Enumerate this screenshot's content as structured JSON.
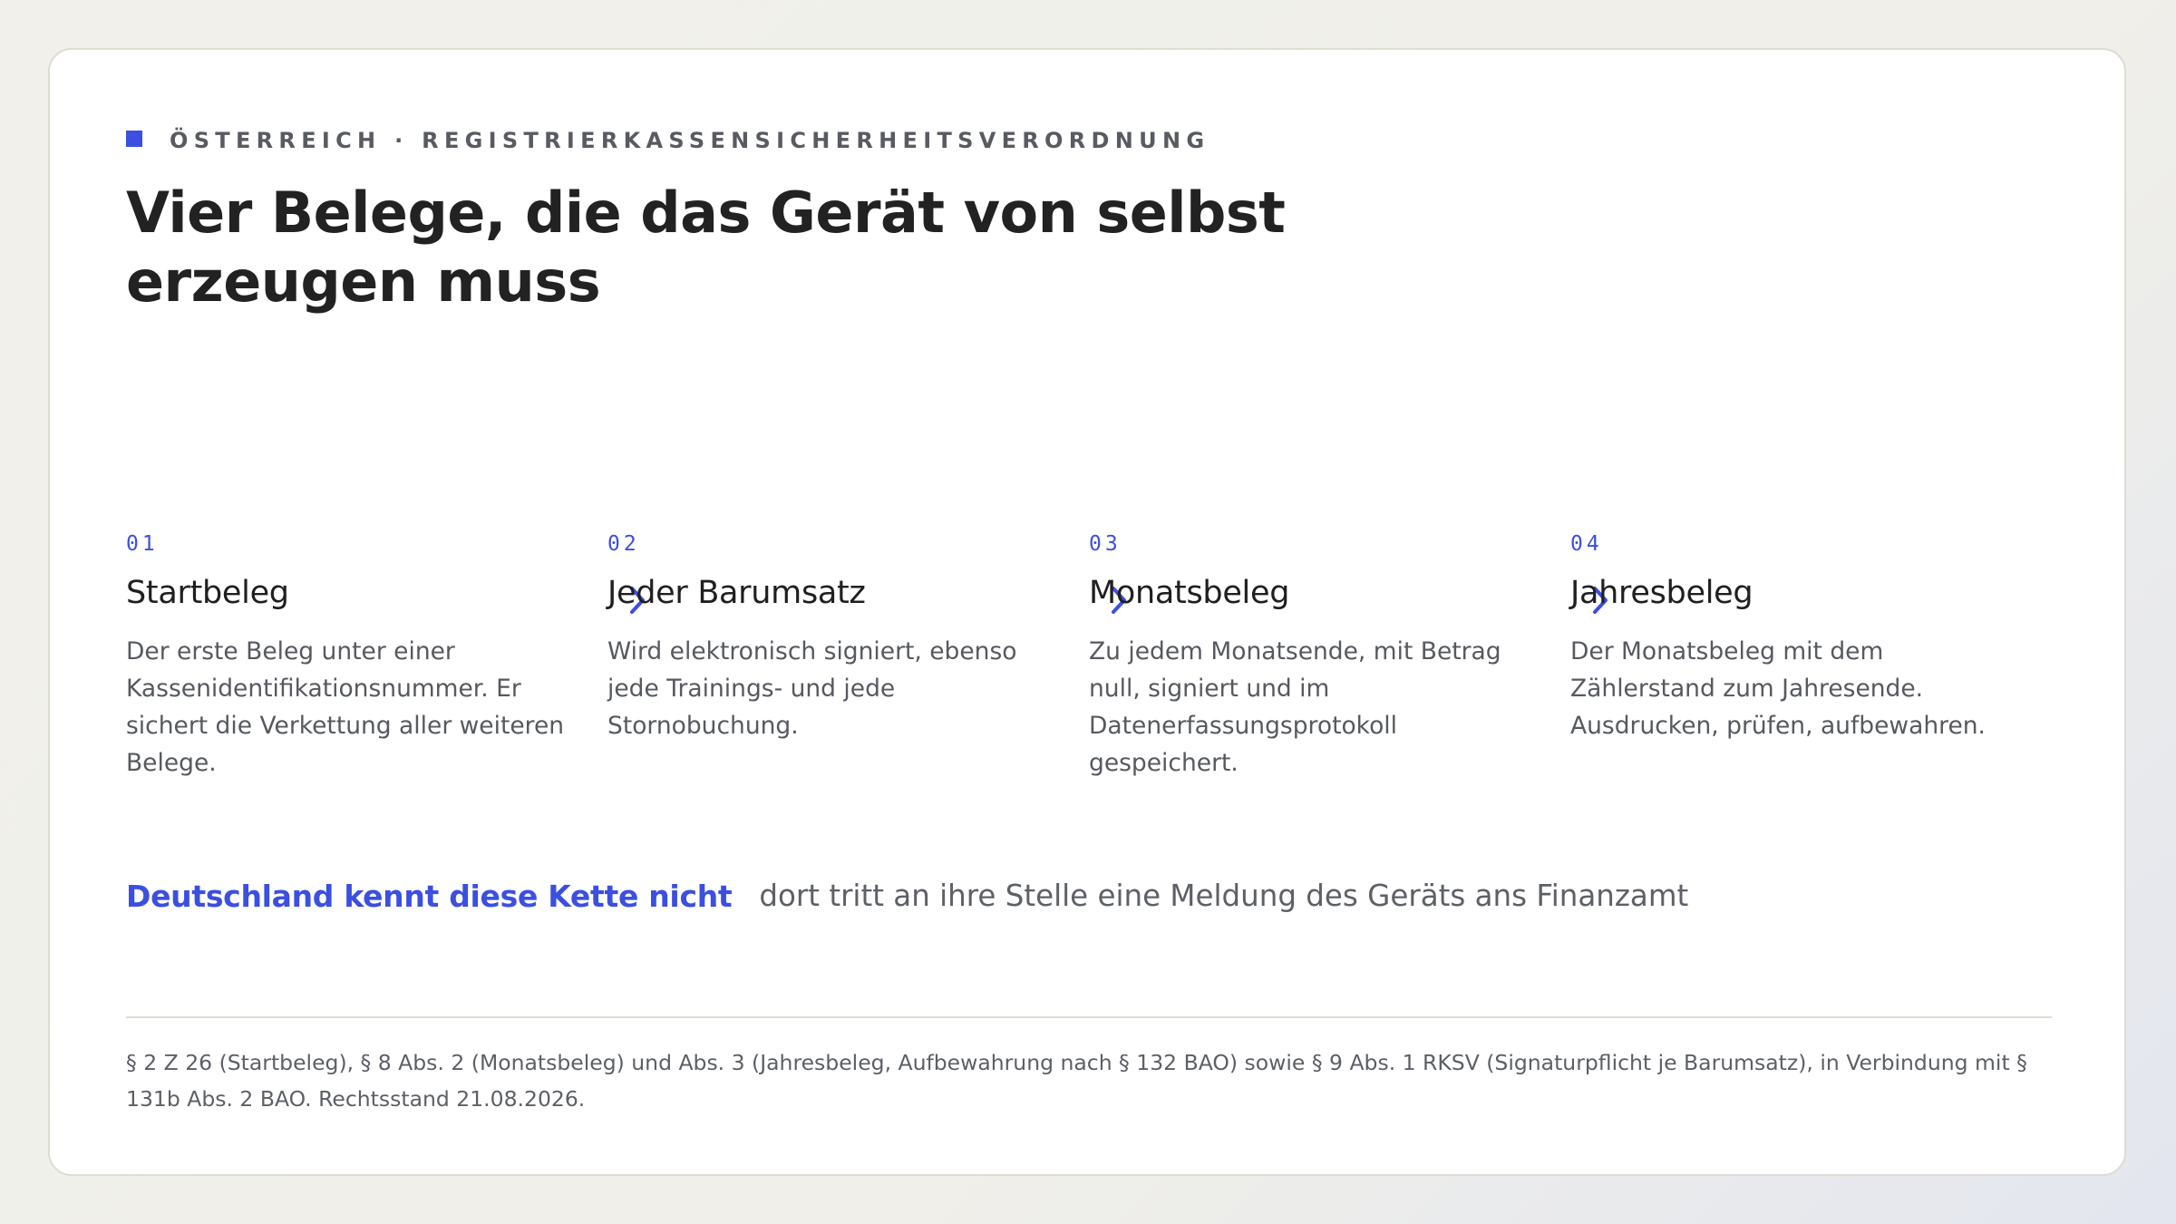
{
  "eyebrow": "ÖSTERREICH · REGISTRIERKASSENSICHERHEITSVERORDNUNG",
  "title": "Vier Belege, die das Gerät von selbst erzeugen muss",
  "steps": [
    {
      "number": "01",
      "title": "Startbeleg",
      "text": "Der erste Beleg unter einer Kassenidentifikationsnummer. Er sichert die Verkettung aller weiteren Belege."
    },
    {
      "number": "02",
      "title": "Jeder Barumsatz",
      "text": "Wird elektronisch signiert, ebenso jede Trainings- und jede Stornobuchung."
    },
    {
      "number": "03",
      "title": "Monatsbeleg",
      "text": "Zu jedem Monatsende, mit Betrag null, signiert und im Datenerfassungsprotokoll gespeichert."
    },
    {
      "number": "04",
      "title": "Jahresbeleg",
      "text": "Der Monatsbeleg mit dem Zählerstand zum Jahresende. Ausdrucken, prüfen, aufbewahren."
    }
  ],
  "note": {
    "strong": "Deutschland kennt diese Kette nicht",
    "rest": "dort tritt an ihre Stelle eine Meldung des Geräts ans Finanzamt"
  },
  "footnote": "§ 2 Z 26 (Startbeleg), § 8 Abs. 2 (Monatsbeleg) und Abs. 3 (Jahresbeleg, Aufbewahrung nach § 132 BAO) sowie § 9 Abs. 1 RKSV (Signaturpflicht je Barumsatz), in Verbindung mit § 131b Abs. 2 BAO. Rechtsstand 21.08.2026.",
  "icons": {
    "eyebrow_marker": "square-marker-icon",
    "step_separator": "chevron-right-icon"
  },
  "colors": {
    "accent": "#3b4fe0",
    "heading": "#222222",
    "body_text": "#56595f",
    "card_background": "#ffffff",
    "page_background": "#f0efe9"
  }
}
